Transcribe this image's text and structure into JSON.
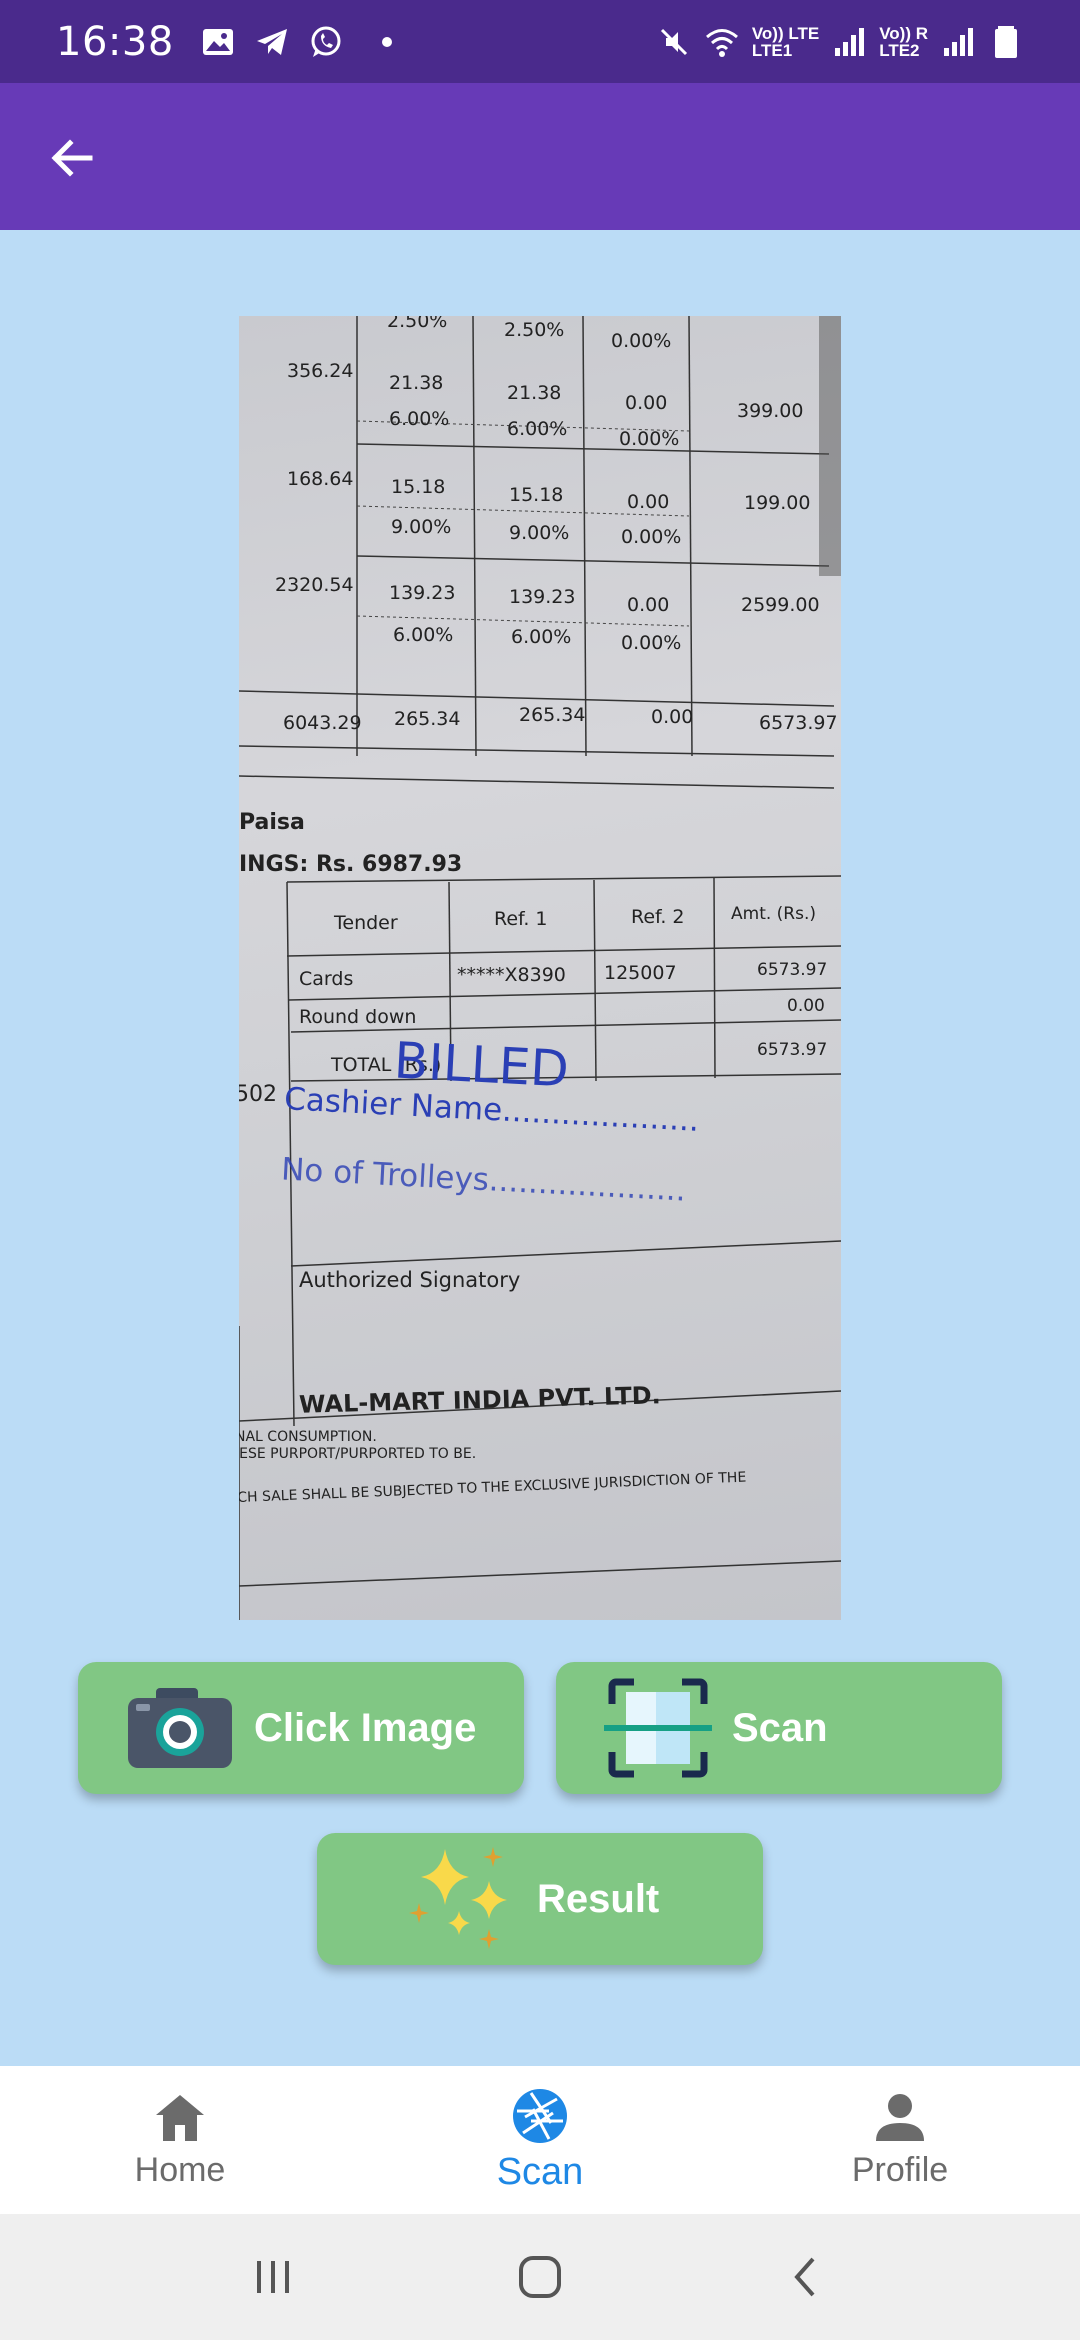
{
  "status_bar": {
    "time": "16:38",
    "left_icons": [
      "image-icon",
      "telegram-icon",
      "whatsapp-icon",
      "dot-icon"
    ],
    "right_icons": [
      "mute-icon",
      "wifi-icon",
      "signal-icon",
      "battery-icon"
    ],
    "lte1_top": "Vo)) LTE",
    "lte1_bottom": "LTE1",
    "lte2_top": "Vo)) R",
    "lte2_bottom": "LTE2"
  },
  "app_bar": {
    "back_icon": "arrow-back-icon"
  },
  "receipt": {
    "rows": [
      {
        "col1": "",
        "col2": "2.50%",
        "col3": "2.50%",
        "col4": "0.00%",
        "col5": ""
      },
      {
        "col1": "356.24",
        "col2": "21.38",
        "col2b": "6.00%",
        "col3": "21.38",
        "col3b": "6.00%",
        "col4": "0.00",
        "col4b": "0.00%",
        "col5": "399.00"
      },
      {
        "col1": "168.64",
        "col2": "15.18",
        "col2b": "9.00%",
        "col3": "15.18",
        "col3b": "9.00%",
        "col4": "0.00",
        "col4b": "0.00%",
        "col5": "199.00"
      },
      {
        "col1": "2320.54",
        "col2": "139.23",
        "col2b": "6.00%",
        "col3": "139.23",
        "col3b": "6.00%",
        "col4": "0.00",
        "col4b": "0.00%",
        "col5": "2599.00"
      }
    ],
    "totals": {
      "col1": "6043.29",
      "col2": "265.34",
      "col3": "265.34",
      "col4": "0.00",
      "col5": "6573.97"
    },
    "paisa": "Paisa",
    "savings": "INGS: Rs. 6987.93",
    "tender_headers": [
      "Tender",
      "Ref. 1",
      "Ref. 2",
      "Amt. (Rs.)"
    ],
    "tender_rows": [
      {
        "tender": "Cards",
        "ref1": "*****X8390",
        "ref2": "125007",
        "amt": "6573.97"
      },
      {
        "tender": "Round down",
        "ref1": "",
        "ref2": "",
        "amt": "0.00"
      },
      {
        "tender": "TOTAL (Rs.)",
        "ref1": "",
        "ref2": "",
        "amt": "6573.97"
      }
    ],
    "side_number": "502",
    "stamp_billed": "BILLED",
    "stamp_cashier": "Cashier Name....................",
    "stamp_trolleys": "No of Trolleys....................",
    "authorized": "Authorized Signatory",
    "company": "WAL-MART INDIA PVT. LTD.",
    "footer1": "NAL CONSUMPTION.",
    "footer2": "IESE PURPORT/PURPORTED TO BE.",
    "footer3": "CH SALE SHALL BE SUBJECTED TO THE EXCLUSIVE JURISDICTION OF THE"
  },
  "buttons": {
    "click_image": {
      "label": "Click Image",
      "icon": "camera-icon"
    },
    "scan": {
      "label": "Scan",
      "icon": "scanner-icon"
    },
    "result": {
      "label": "Result",
      "icon": "sparkles-icon"
    }
  },
  "bottom_nav": [
    {
      "label": "Home",
      "icon": "home-icon",
      "active": false
    },
    {
      "label": "Scan",
      "icon": "aperture-icon",
      "active": true
    },
    {
      "label": "Profile",
      "icon": "person-icon",
      "active": false
    }
  ],
  "system_nav": [
    "recents-icon",
    "home-circle-icon",
    "back-chevron-icon"
  ],
  "colors": {
    "status_bar": "#4a2a8c",
    "app_bar": "#673ab7",
    "background": "#bbdcf6",
    "button": "#81c784",
    "active_nav": "#1e88e5",
    "stamp_ink": "#2a3fb5"
  }
}
